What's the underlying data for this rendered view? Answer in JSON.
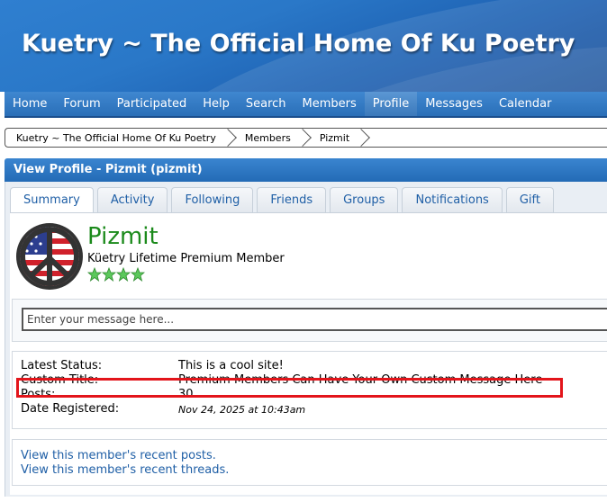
{
  "site": {
    "title": "Kuetry ~ The Official Home Of Ku Poetry"
  },
  "nav": {
    "items": [
      {
        "label": "Home"
      },
      {
        "label": "Forum"
      },
      {
        "label": "Participated"
      },
      {
        "label": "Help"
      },
      {
        "label": "Search"
      },
      {
        "label": "Members"
      },
      {
        "label": "Profile",
        "active": true
      },
      {
        "label": "Messages"
      },
      {
        "label": "Calendar"
      }
    ]
  },
  "breadcrumb": [
    "Kuetry ~ The Official Home Of Ku Poetry",
    "Members",
    "Pizmit"
  ],
  "panel": {
    "title": "View Profile - Pizmit (pizmit)"
  },
  "tabs": [
    "Summary",
    "Activity",
    "Following",
    "Friends",
    "Groups",
    "Notifications",
    "Gift"
  ],
  "profile": {
    "username": "Pizmit",
    "user_title": "Küetry Lifetime Premium Member",
    "stars": 4,
    "star_color": "#5cc85c",
    "avatar_icon": "peace-sign-flag-icon"
  },
  "message": {
    "placeholder": "Enter your message here..."
  },
  "stats": {
    "latest_status_label": "Latest Status:",
    "latest_status_value": "This is a cool site!",
    "custom_title_label": "Custom Title:",
    "custom_title_value": "Premium Members Can Have Your Own Custom Message Here",
    "posts_label": "Posts:",
    "posts_value": "30",
    "registered_label": "Date Registered:",
    "registered_value": "Nov 24, 2025 at 10:43am"
  },
  "links": {
    "recent_posts": "View this member's recent posts.",
    "recent_threads": "View this member's recent threads."
  },
  "colors": {
    "accent": "#2a6fb8",
    "username": "#1b8a1b",
    "link": "#1f5fa6",
    "highlight": "#e3151b"
  }
}
